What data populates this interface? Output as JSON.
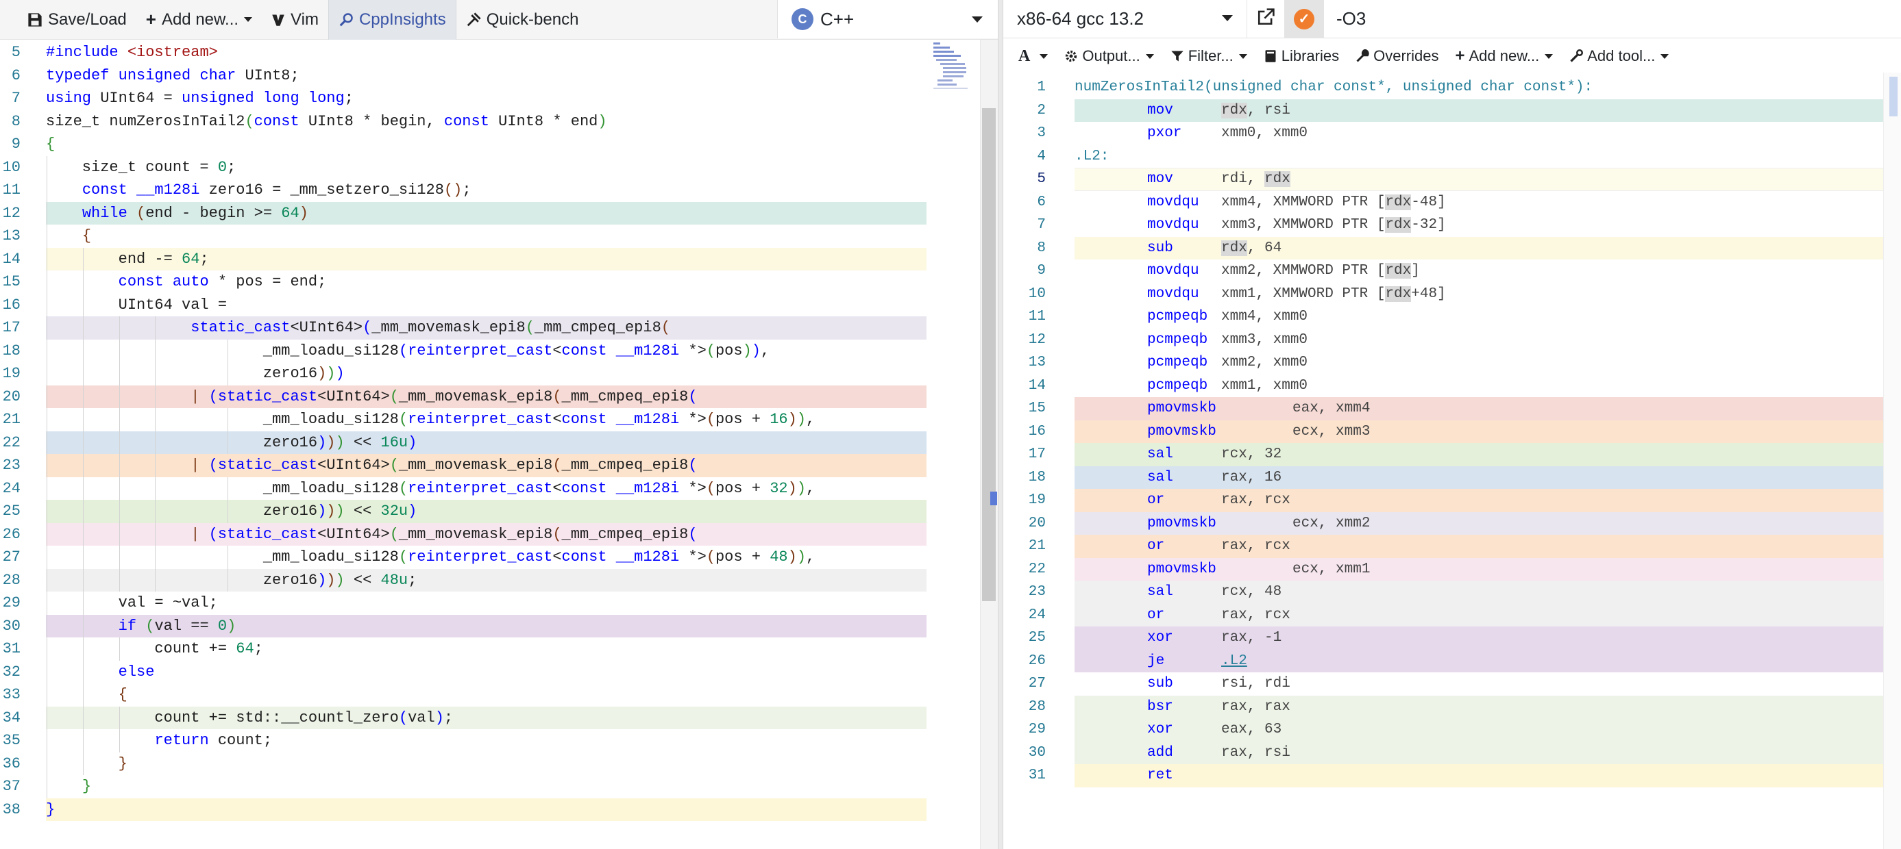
{
  "left_toolbar": {
    "items": [
      {
        "label": "Save/Load",
        "icon": "save-icon"
      },
      {
        "label": "Add new...",
        "icon": "plus-icon",
        "dropdown": true
      },
      {
        "label": "Vim",
        "icon": "vim-icon"
      },
      {
        "label": "CppInsights",
        "icon": "search-icon",
        "active": true
      },
      {
        "label": "Quick-bench",
        "icon": "bench-icon"
      }
    ],
    "language": "C++"
  },
  "source": {
    "lines": [
      {
        "n": "5",
        "bg": "",
        "indent": 0,
        "h": "<span class='k'>#include</span> <span class='s'>&lt;iostream&gt;</span>"
      },
      {
        "n": "6",
        "bg": "",
        "indent": 0,
        "h": "<span class='k'>typedef</span> <span class='k'>unsigned</span> <span class='k'>char</span> UInt8;"
      },
      {
        "n": "7",
        "bg": "",
        "indent": 0,
        "h": "<span class='k'>using</span> UInt64 = <span class='k'>unsigned</span> <span class='k'>long</span> <span class='k'>long</span>;"
      },
      {
        "n": "8",
        "bg": "",
        "indent": 0,
        "h": "size_t numZerosInTail2<span class='b1'>(</span><span class='k'>const</span> UInt8 * begin, <span class='k'>const</span> UInt8 * end<span class='b1'>)</span>"
      },
      {
        "n": "9",
        "bg": "",
        "indent": 0,
        "h": "<span class='b1'>{</span>"
      },
      {
        "n": "10",
        "bg": "",
        "indent": 1,
        "h": "    size_t count = <span class='n'>0</span>;"
      },
      {
        "n": "11",
        "bg": "",
        "indent": 1,
        "h": "    <span class='k'>const</span> <span class='k'>__m128i</span> zero16 = _mm_setzero_si128<span class='b2'>()</span>;"
      },
      {
        "n": "12",
        "bg": "#d8ece7",
        "indent": 1,
        "h": "    <span class='k'>while</span> <span class='b2'>(</span>end - begin &gt;= <span class='n'>64</span><span class='b2'>)</span>"
      },
      {
        "n": "13",
        "bg": "",
        "indent": 1,
        "h": "    <span class='b2'>{</span>"
      },
      {
        "n": "14",
        "bg": "#fdf9e1",
        "indent": 2,
        "h": "        end -= <span class='n'>64</span>;"
      },
      {
        "n": "15",
        "bg": "",
        "indent": 2,
        "h": "        <span class='k'>const</span> <span class='k'>auto</span> * pos = end;"
      },
      {
        "n": "16",
        "bg": "",
        "indent": 2,
        "h": "        UInt64 val ="
      },
      {
        "n": "17",
        "bg": "#e9e6f0",
        "indent": 4,
        "h": "                <span class='k'>static_cast</span>&lt;UInt64&gt;<span class='k'>(</span>_mm_movemask_epi8<span class='b1'>(</span>_mm_cmpeq_epi8<span class='b2'>(</span>"
      },
      {
        "n": "18",
        "bg": "",
        "indent": 6,
        "h": "                        _mm_loadu_si128<span class='k'>(</span><span class='k'>reinterpret_cast</span>&lt;<span class='k'>const</span> <span class='k'>__m128i</span> *&gt;<span class='b1'>(</span>pos<span class='b1'>)</span><span class='k'>)</span>,"
      },
      {
        "n": "19",
        "bg": "",
        "indent": 6,
        "h": "                        zero16<span class='b2'>)</span><span class='b1'>)</span><span class='k'>)</span>"
      },
      {
        "n": "20",
        "bg": "#f6dad5",
        "indent": 4,
        "h": "                <span class='b2'>|</span> <span class='k'>(</span><span class='k'>static_cast</span>&lt;UInt64&gt;<span class='b1'>(</span>_mm_movemask_epi8<span class='b2'>(</span>_mm_cmpeq_epi8<span class='k'>(</span>"
      },
      {
        "n": "21",
        "bg": "",
        "indent": 6,
        "h": "                        _mm_loadu_si128<span class='b1'>(</span><span class='k'>reinterpret_cast</span>&lt;<span class='k'>const</span> <span class='k'>__m128i</span> *&gt;<span class='b2'>(</span>pos + <span class='n'>16</span><span class='b2'>)</span><span class='b1'>)</span>,"
      },
      {
        "n": "22",
        "bg": "#d7e3ef",
        "indent": 6,
        "h": "                        zero16<span class='k'>)</span><span class='b2'>)</span><span class='b1'>)</span> &lt;&lt; <span class='n'>16u</span><span class='k'>)</span>"
      },
      {
        "n": "23",
        "bg": "#fbe3cd",
        "indent": 4,
        "h": "                <span class='b2'>|</span> <span class='k'>(</span><span class='k'>static_cast</span>&lt;UInt64&gt;<span class='b1'>(</span>_mm_movemask_epi8<span class='b2'>(</span>_mm_cmpeq_epi8<span class='k'>(</span>"
      },
      {
        "n": "24",
        "bg": "",
        "indent": 6,
        "h": "                        _mm_loadu_si128<span class='b1'>(</span><span class='k'>reinterpret_cast</span>&lt;<span class='k'>const</span> <span class='k'>__m128i</span> *&gt;<span class='b2'>(</span>pos + <span class='n'>32</span><span class='b2'>)</span><span class='b1'>)</span>,"
      },
      {
        "n": "25",
        "bg": "#e5f0da",
        "indent": 6,
        "h": "                        zero16<span class='k'>)</span><span class='b2'>)</span><span class='b1'>)</span> &lt;&lt; <span class='n'>32u</span><span class='k'>)</span>"
      },
      {
        "n": "26",
        "bg": "#f8e6ee",
        "indent": 4,
        "h": "                <span class='b2'>|</span> <span class='k'>(</span><span class='k'>static_cast</span>&lt;UInt64&gt;<span class='b1'>(</span>_mm_movemask_epi8<span class='b2'>(</span>_mm_cmpeq_epi8<span class='k'>(</span>"
      },
      {
        "n": "27",
        "bg": "",
        "indent": 6,
        "h": "                        _mm_loadu_si128<span class='b1'>(</span><span class='k'>reinterpret_cast</span>&lt;<span class='k'>const</span> <span class='k'>__m128i</span> *&gt;<span class='b2'>(</span>pos + <span class='n'>48</span><span class='b2'>)</span><span class='b1'>)</span>,"
      },
      {
        "n": "28",
        "bg": "#f0f0f0",
        "indent": 6,
        "h": "                        zero16<span class='k'>)</span><span class='b2'>)</span><span class='b1'>)</span> &lt;&lt; <span class='n'>48u</span>;"
      },
      {
        "n": "29",
        "bg": "",
        "indent": 2,
        "h": "        val = ~val;"
      },
      {
        "n": "30",
        "bg": "#e6d9ec",
        "indent": 2,
        "h": "        <span class='k'>if</span> <span class='b1'>(</span>val == <span class='n'>0</span><span class='b1'>)</span>"
      },
      {
        "n": "31",
        "bg": "",
        "indent": 3,
        "h": "            count += <span class='n'>64</span>;"
      },
      {
        "n": "32",
        "bg": "",
        "indent": 2,
        "h": "        <span class='k'>else</span>"
      },
      {
        "n": "33",
        "bg": "",
        "indent": 2,
        "h": "        <span class='b2'>{</span>"
      },
      {
        "n": "34",
        "bg": "#edf4e7",
        "indent": 3,
        "h": "            count += std::__countl_zero<span class='k'>(</span>val<span class='k'>)</span>;"
      },
      {
        "n": "35",
        "bg": "",
        "indent": 3,
        "h": "            <span class='k'>return</span> count;"
      },
      {
        "n": "36",
        "bg": "",
        "indent": 2,
        "h": "        <span class='b2'>}</span>"
      },
      {
        "n": "37",
        "bg": "",
        "indent": 1,
        "h": "    <span class='b1'>}</span>"
      },
      {
        "n": "38",
        "bg": "#fdf7d8",
        "indent": 0,
        "h": "<span class='k'>}</span>"
      }
    ]
  },
  "compiler": {
    "name": "x86-64 gcc 13.2",
    "options": "-O3",
    "toolbar": [
      {
        "label": "",
        "icon": "font-icon",
        "dropdown": true
      },
      {
        "label": "Output...",
        "icon": "gear-icon",
        "dropdown": true
      },
      {
        "label": "Filter...",
        "icon": "filter-icon",
        "dropdown": true
      },
      {
        "label": "Libraries",
        "icon": "book-icon",
        "dropdown": false
      },
      {
        "label": "Overrides",
        "icon": "wrench-icon",
        "dropdown": false
      },
      {
        "label": "Add new...",
        "icon": "plus-icon",
        "dropdown": true
      },
      {
        "label": "Add tool...",
        "icon": "tool-icon",
        "dropdown": true
      }
    ]
  },
  "assembly": {
    "lines": [
      {
        "n": "1",
        "bg": "",
        "label": "numZerosInTail2(unsigned char const*, unsigned char const*):",
        "op": "",
        "args": ""
      },
      {
        "n": "2",
        "bg": "#d8ece7",
        "label": "",
        "op": "mov",
        "args": "<span class='reg'>rdx</span>, rsi"
      },
      {
        "n": "3",
        "bg": "",
        "label": "",
        "op": "pxor",
        "args": "xmm0, xmm0"
      },
      {
        "n": "4",
        "bg": "",
        "label": ".L2:",
        "op": "",
        "args": ""
      },
      {
        "n": "5",
        "bg": "#fdfbea",
        "label": "",
        "op": "mov",
        "args": "rdi, <span class='reg'>rdx</span>"
      },
      {
        "n": "6",
        "bg": "",
        "label": "",
        "op": "movdqu",
        "args": "xmm4, XMMWORD PTR [<span class='reg'>rdx</span>-48]"
      },
      {
        "n": "7",
        "bg": "",
        "label": "",
        "op": "movdqu",
        "args": "xmm3, XMMWORD PTR [<span class='reg'>rdx</span>-32]"
      },
      {
        "n": "8",
        "bg": "#fdf9e1",
        "label": "",
        "op": "sub",
        "args": "<span class='reg'>rdx</span>, 64"
      },
      {
        "n": "9",
        "bg": "",
        "label": "",
        "op": "movdqu",
        "args": "xmm2, XMMWORD PTR [<span class='reg'>rdx</span>]"
      },
      {
        "n": "10",
        "bg": "",
        "label": "",
        "op": "movdqu",
        "args": "xmm1, XMMWORD PTR [<span class='reg'>rdx</span>+48]"
      },
      {
        "n": "11",
        "bg": "",
        "label": "",
        "op": "pcmpeqb",
        "args": "xmm4, xmm0"
      },
      {
        "n": "12",
        "bg": "",
        "label": "",
        "op": "pcmpeqb",
        "args": "xmm3, xmm0"
      },
      {
        "n": "13",
        "bg": "",
        "label": "",
        "op": "pcmpeqb",
        "args": "xmm2, xmm0"
      },
      {
        "n": "14",
        "bg": "",
        "label": "",
        "op": "pcmpeqb",
        "args": "xmm1, xmm0"
      },
      {
        "n": "15",
        "bg": "#f6dad5",
        "label": "",
        "op": "pmovmskb",
        "args": "eax, xmm4",
        "wide": true
      },
      {
        "n": "16",
        "bg": "#fbe3cd",
        "label": "",
        "op": "pmovmskb",
        "args": "ecx, xmm3",
        "wide": true
      },
      {
        "n": "17",
        "bg": "#e5f0da",
        "label": "",
        "op": "sal",
        "args": "rcx, 32"
      },
      {
        "n": "18",
        "bg": "#d7e3ef",
        "label": "",
        "op": "sal",
        "args": "rax, 16"
      },
      {
        "n": "19",
        "bg": "#fbe3cd",
        "label": "",
        "op": "or",
        "args": "rax, rcx"
      },
      {
        "n": "20",
        "bg": "#e9e6f0",
        "label": "",
        "op": "pmovmskb",
        "args": "ecx, xmm2",
        "wide": true
      },
      {
        "n": "21",
        "bg": "#fbe3cd",
        "label": "",
        "op": "or",
        "args": "rax, rcx"
      },
      {
        "n": "22",
        "bg": "#f8e6ee",
        "label": "",
        "op": "pmovmskb",
        "args": "ecx, xmm1",
        "wide": true
      },
      {
        "n": "23",
        "bg": "#f0f0f0",
        "label": "",
        "op": "sal",
        "args": "rcx, 48"
      },
      {
        "n": "24",
        "bg": "#f0f0f0",
        "label": "",
        "op": "or",
        "args": "rax, rcx"
      },
      {
        "n": "25",
        "bg": "#e6d9ec",
        "label": "",
        "op": "xor",
        "args": "rax, -1"
      },
      {
        "n": "26",
        "bg": "#e6d9ec",
        "label": "",
        "op": "je",
        "args": "<span style='color:#267f99;text-decoration:underline'>.L2</span>"
      },
      {
        "n": "27",
        "bg": "",
        "label": "",
        "op": "sub",
        "args": "rsi, rdi"
      },
      {
        "n": "28",
        "bg": "#edf4e7",
        "label": "",
        "op": "bsr",
        "args": "rax, rax"
      },
      {
        "n": "29",
        "bg": "#edf4e7",
        "label": "",
        "op": "xor",
        "args": "eax, 63"
      },
      {
        "n": "30",
        "bg": "#edf4e7",
        "label": "",
        "op": "add",
        "args": "rax, rsi"
      },
      {
        "n": "31",
        "bg": "#fdf7d8",
        "label": "",
        "op": "ret",
        "args": ""
      }
    ]
  }
}
